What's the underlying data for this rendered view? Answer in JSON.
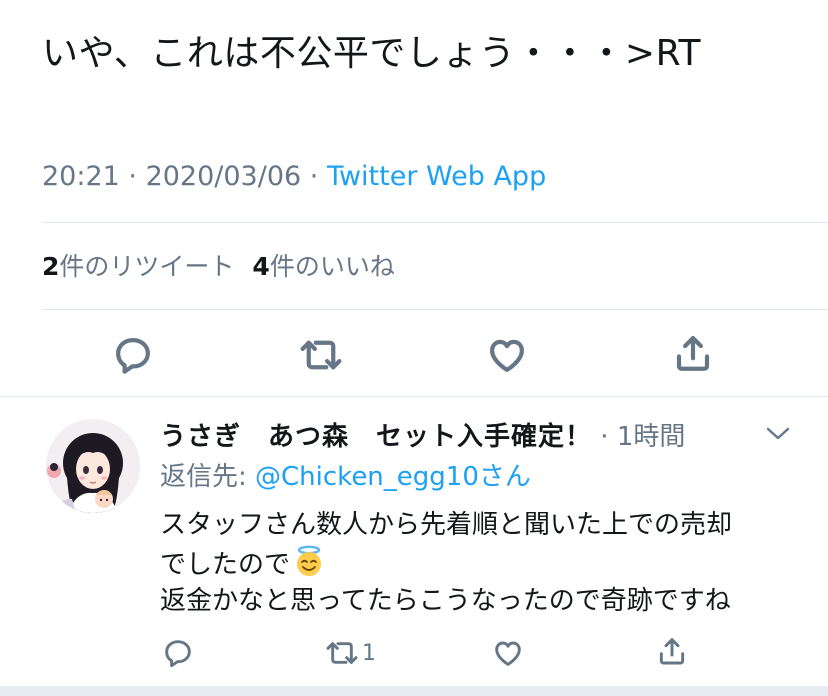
{
  "tweet": {
    "text": "いや、これは不公平でしょう・・・>RT",
    "time": "20:21",
    "sep1": " · ",
    "date": "2020/03/06",
    "sep2": " · ",
    "source": "Twitter Web App"
  },
  "stats": {
    "retweet_count": "2",
    "retweet_label": "件のリツイート",
    "like_count": "4",
    "like_label": "件のいいね"
  },
  "actions": [
    "reply-icon",
    "retweet-icon",
    "like-icon",
    "share-icon"
  ],
  "reply": {
    "name": "うさぎ　あつ森　セット入手確定！",
    "sep": " · ",
    "time": "1時間",
    "reply_to_label": "返信先: ",
    "reply_to_handle": "@Chicken_egg10さん",
    "body_line1": "スタッフさん数人から先着順と聞いた上での売却",
    "body_line2": "でしたので",
    "body_line3": "返金かなと思ってたらこうなったので奇跡ですね",
    "emoji": "smiling-face-with-halo",
    "retweet_count": "1"
  },
  "colors": {
    "text": "#14171a",
    "secondary": "#657786",
    "link": "#1da1f2",
    "divider": "#e1e8ed"
  }
}
